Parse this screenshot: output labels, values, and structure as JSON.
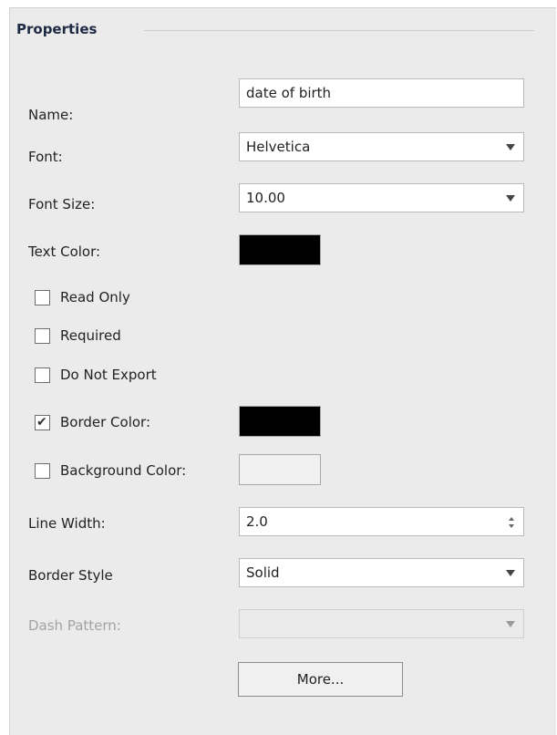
{
  "properties": {
    "title": "Properties",
    "name": {
      "label": "Name:",
      "value": "date of birth"
    },
    "font": {
      "label": "Font:",
      "value": "Helvetica"
    },
    "font_size": {
      "label": "Font Size:",
      "value": "10.00"
    },
    "text_color": {
      "label": "Text Color:",
      "color": "#000000"
    },
    "read_only": {
      "label": "Read Only",
      "checked": false
    },
    "required": {
      "label": "Required",
      "checked": false
    },
    "do_not_export": {
      "label": "Do Not Export",
      "checked": false
    },
    "border_color": {
      "label": "Border Color:",
      "checked": true,
      "check_glyph": "✔",
      "color": "#000000"
    },
    "background_color": {
      "label": "Background Color:",
      "checked": false,
      "color": "#f0f0f0"
    },
    "line_width": {
      "label": "Line Width:",
      "value": "2.0"
    },
    "border_style": {
      "label": "Border Style",
      "value": "Solid"
    },
    "dash_pattern": {
      "label": "Dash Pattern:",
      "value": "",
      "disabled": true
    },
    "more_button": {
      "label": "More..."
    }
  },
  "icons": {
    "dropdown": "chevron-down-icon",
    "spinner": "spinner-arrows-icon",
    "check": "checkmark-icon"
  }
}
